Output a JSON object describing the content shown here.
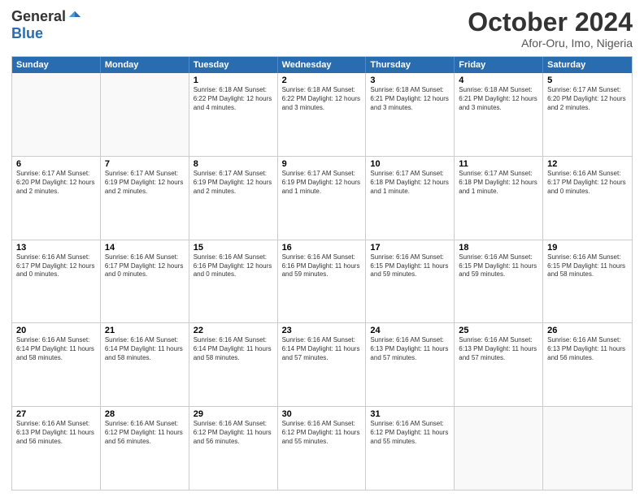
{
  "logo": {
    "general": "General",
    "blue": "Blue"
  },
  "title": {
    "month_year": "October 2024",
    "location": "Afor-Oru, Imo, Nigeria"
  },
  "header_days": [
    "Sunday",
    "Monday",
    "Tuesday",
    "Wednesday",
    "Thursday",
    "Friday",
    "Saturday"
  ],
  "weeks": [
    [
      {
        "day": "",
        "info": "",
        "empty": true
      },
      {
        "day": "",
        "info": "",
        "empty": true
      },
      {
        "day": "1",
        "info": "Sunrise: 6:18 AM\nSunset: 6:22 PM\nDaylight: 12 hours and 4 minutes."
      },
      {
        "day": "2",
        "info": "Sunrise: 6:18 AM\nSunset: 6:22 PM\nDaylight: 12 hours and 3 minutes."
      },
      {
        "day": "3",
        "info": "Sunrise: 6:18 AM\nSunset: 6:21 PM\nDaylight: 12 hours and 3 minutes."
      },
      {
        "day": "4",
        "info": "Sunrise: 6:18 AM\nSunset: 6:21 PM\nDaylight: 12 hours and 3 minutes."
      },
      {
        "day": "5",
        "info": "Sunrise: 6:17 AM\nSunset: 6:20 PM\nDaylight: 12 hours and 2 minutes."
      }
    ],
    [
      {
        "day": "6",
        "info": "Sunrise: 6:17 AM\nSunset: 6:20 PM\nDaylight: 12 hours and 2 minutes."
      },
      {
        "day": "7",
        "info": "Sunrise: 6:17 AM\nSunset: 6:19 PM\nDaylight: 12 hours and 2 minutes."
      },
      {
        "day": "8",
        "info": "Sunrise: 6:17 AM\nSunset: 6:19 PM\nDaylight: 12 hours and 2 minutes."
      },
      {
        "day": "9",
        "info": "Sunrise: 6:17 AM\nSunset: 6:19 PM\nDaylight: 12 hours and 1 minute."
      },
      {
        "day": "10",
        "info": "Sunrise: 6:17 AM\nSunset: 6:18 PM\nDaylight: 12 hours and 1 minute."
      },
      {
        "day": "11",
        "info": "Sunrise: 6:17 AM\nSunset: 6:18 PM\nDaylight: 12 hours and 1 minute."
      },
      {
        "day": "12",
        "info": "Sunrise: 6:16 AM\nSunset: 6:17 PM\nDaylight: 12 hours and 0 minutes."
      }
    ],
    [
      {
        "day": "13",
        "info": "Sunrise: 6:16 AM\nSunset: 6:17 PM\nDaylight: 12 hours and 0 minutes."
      },
      {
        "day": "14",
        "info": "Sunrise: 6:16 AM\nSunset: 6:17 PM\nDaylight: 12 hours and 0 minutes."
      },
      {
        "day": "15",
        "info": "Sunrise: 6:16 AM\nSunset: 6:16 PM\nDaylight: 12 hours and 0 minutes."
      },
      {
        "day": "16",
        "info": "Sunrise: 6:16 AM\nSunset: 6:16 PM\nDaylight: 11 hours and 59 minutes."
      },
      {
        "day": "17",
        "info": "Sunrise: 6:16 AM\nSunset: 6:15 PM\nDaylight: 11 hours and 59 minutes."
      },
      {
        "day": "18",
        "info": "Sunrise: 6:16 AM\nSunset: 6:15 PM\nDaylight: 11 hours and 59 minutes."
      },
      {
        "day": "19",
        "info": "Sunrise: 6:16 AM\nSunset: 6:15 PM\nDaylight: 11 hours and 58 minutes."
      }
    ],
    [
      {
        "day": "20",
        "info": "Sunrise: 6:16 AM\nSunset: 6:14 PM\nDaylight: 11 hours and 58 minutes."
      },
      {
        "day": "21",
        "info": "Sunrise: 6:16 AM\nSunset: 6:14 PM\nDaylight: 11 hours and 58 minutes."
      },
      {
        "day": "22",
        "info": "Sunrise: 6:16 AM\nSunset: 6:14 PM\nDaylight: 11 hours and 58 minutes."
      },
      {
        "day": "23",
        "info": "Sunrise: 6:16 AM\nSunset: 6:14 PM\nDaylight: 11 hours and 57 minutes."
      },
      {
        "day": "24",
        "info": "Sunrise: 6:16 AM\nSunset: 6:13 PM\nDaylight: 11 hours and 57 minutes."
      },
      {
        "day": "25",
        "info": "Sunrise: 6:16 AM\nSunset: 6:13 PM\nDaylight: 11 hours and 57 minutes."
      },
      {
        "day": "26",
        "info": "Sunrise: 6:16 AM\nSunset: 6:13 PM\nDaylight: 11 hours and 56 minutes."
      }
    ],
    [
      {
        "day": "27",
        "info": "Sunrise: 6:16 AM\nSunset: 6:13 PM\nDaylight: 11 hours and 56 minutes."
      },
      {
        "day": "28",
        "info": "Sunrise: 6:16 AM\nSunset: 6:12 PM\nDaylight: 11 hours and 56 minutes."
      },
      {
        "day": "29",
        "info": "Sunrise: 6:16 AM\nSunset: 6:12 PM\nDaylight: 11 hours and 56 minutes."
      },
      {
        "day": "30",
        "info": "Sunrise: 6:16 AM\nSunset: 6:12 PM\nDaylight: 11 hours and 55 minutes."
      },
      {
        "day": "31",
        "info": "Sunrise: 6:16 AM\nSunset: 6:12 PM\nDaylight: 11 hours and 55 minutes."
      },
      {
        "day": "",
        "info": "",
        "empty": true
      },
      {
        "day": "",
        "info": "",
        "empty": true
      }
    ]
  ]
}
